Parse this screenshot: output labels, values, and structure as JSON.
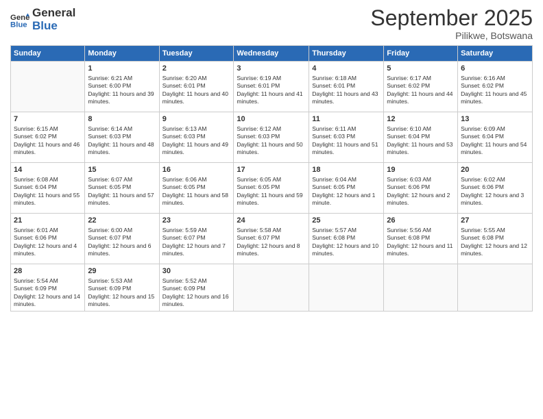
{
  "header": {
    "logo_line1": "General",
    "logo_line2": "Blue",
    "month": "September 2025",
    "location": "Pilikwe, Botswana"
  },
  "days_of_week": [
    "Sunday",
    "Monday",
    "Tuesday",
    "Wednesday",
    "Thursday",
    "Friday",
    "Saturday"
  ],
  "weeks": [
    [
      {
        "day": null,
        "content": null
      },
      {
        "day": 1,
        "sunrise": "6:21 AM",
        "sunset": "6:00 PM",
        "daylight": "11 hours and 39 minutes."
      },
      {
        "day": 2,
        "sunrise": "6:20 AM",
        "sunset": "6:01 PM",
        "daylight": "11 hours and 40 minutes."
      },
      {
        "day": 3,
        "sunrise": "6:19 AM",
        "sunset": "6:01 PM",
        "daylight": "11 hours and 41 minutes."
      },
      {
        "day": 4,
        "sunrise": "6:18 AM",
        "sunset": "6:01 PM",
        "daylight": "11 hours and 43 minutes."
      },
      {
        "day": 5,
        "sunrise": "6:17 AM",
        "sunset": "6:02 PM",
        "daylight": "11 hours and 44 minutes."
      },
      {
        "day": 6,
        "sunrise": "6:16 AM",
        "sunset": "6:02 PM",
        "daylight": "11 hours and 45 minutes."
      }
    ],
    [
      {
        "day": 7,
        "sunrise": "6:15 AM",
        "sunset": "6:02 PM",
        "daylight": "11 hours and 46 minutes."
      },
      {
        "day": 8,
        "sunrise": "6:14 AM",
        "sunset": "6:03 PM",
        "daylight": "11 hours and 48 minutes."
      },
      {
        "day": 9,
        "sunrise": "6:13 AM",
        "sunset": "6:03 PM",
        "daylight": "11 hours and 49 minutes."
      },
      {
        "day": 10,
        "sunrise": "6:12 AM",
        "sunset": "6:03 PM",
        "daylight": "11 hours and 50 minutes."
      },
      {
        "day": 11,
        "sunrise": "6:11 AM",
        "sunset": "6:03 PM",
        "daylight": "11 hours and 51 minutes."
      },
      {
        "day": 12,
        "sunrise": "6:10 AM",
        "sunset": "6:04 PM",
        "daylight": "11 hours and 53 minutes."
      },
      {
        "day": 13,
        "sunrise": "6:09 AM",
        "sunset": "6:04 PM",
        "daylight": "11 hours and 54 minutes."
      }
    ],
    [
      {
        "day": 14,
        "sunrise": "6:08 AM",
        "sunset": "6:04 PM",
        "daylight": "11 hours and 55 minutes."
      },
      {
        "day": 15,
        "sunrise": "6:07 AM",
        "sunset": "6:05 PM",
        "daylight": "11 hours and 57 minutes."
      },
      {
        "day": 16,
        "sunrise": "6:06 AM",
        "sunset": "6:05 PM",
        "daylight": "11 hours and 58 minutes."
      },
      {
        "day": 17,
        "sunrise": "6:05 AM",
        "sunset": "6:05 PM",
        "daylight": "11 hours and 59 minutes."
      },
      {
        "day": 18,
        "sunrise": "6:04 AM",
        "sunset": "6:05 PM",
        "daylight": "12 hours and 1 minute."
      },
      {
        "day": 19,
        "sunrise": "6:03 AM",
        "sunset": "6:06 PM",
        "daylight": "12 hours and 2 minutes."
      },
      {
        "day": 20,
        "sunrise": "6:02 AM",
        "sunset": "6:06 PM",
        "daylight": "12 hours and 3 minutes."
      }
    ],
    [
      {
        "day": 21,
        "sunrise": "6:01 AM",
        "sunset": "6:06 PM",
        "daylight": "12 hours and 4 minutes."
      },
      {
        "day": 22,
        "sunrise": "6:00 AM",
        "sunset": "6:07 PM",
        "daylight": "12 hours and 6 minutes."
      },
      {
        "day": 23,
        "sunrise": "5:59 AM",
        "sunset": "6:07 PM",
        "daylight": "12 hours and 7 minutes."
      },
      {
        "day": 24,
        "sunrise": "5:58 AM",
        "sunset": "6:07 PM",
        "daylight": "12 hours and 8 minutes."
      },
      {
        "day": 25,
        "sunrise": "5:57 AM",
        "sunset": "6:08 PM",
        "daylight": "12 hours and 10 minutes."
      },
      {
        "day": 26,
        "sunrise": "5:56 AM",
        "sunset": "6:08 PM",
        "daylight": "12 hours and 11 minutes."
      },
      {
        "day": 27,
        "sunrise": "5:55 AM",
        "sunset": "6:08 PM",
        "daylight": "12 hours and 12 minutes."
      }
    ],
    [
      {
        "day": 28,
        "sunrise": "5:54 AM",
        "sunset": "6:09 PM",
        "daylight": "12 hours and 14 minutes."
      },
      {
        "day": 29,
        "sunrise": "5:53 AM",
        "sunset": "6:09 PM",
        "daylight": "12 hours and 15 minutes."
      },
      {
        "day": 30,
        "sunrise": "5:52 AM",
        "sunset": "6:09 PM",
        "daylight": "12 hours and 16 minutes."
      },
      {
        "day": null,
        "content": null
      },
      {
        "day": null,
        "content": null
      },
      {
        "day": null,
        "content": null
      },
      {
        "day": null,
        "content": null
      }
    ]
  ]
}
